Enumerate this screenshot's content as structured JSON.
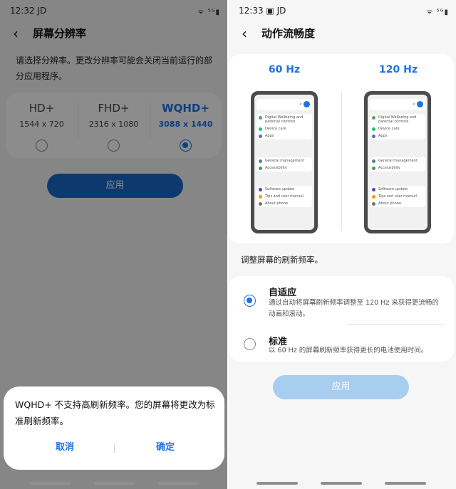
{
  "left": {
    "status_time": "12:32",
    "status_carrier": "JD",
    "status_icons": "ᯤ ⁵ᴳ▮",
    "title": "屏幕分辨率",
    "description": "请选择分辨率。更改分辨率可能会关闭当前运行的部分应用程序。",
    "resolutions": [
      {
        "name": "HD+",
        "dims": "1544 x 720",
        "selected": false
      },
      {
        "name": "FHD+",
        "dims": "2316 x 1080",
        "selected": false
      },
      {
        "name": "WQHD+",
        "dims": "3088 x 1440",
        "selected": true
      }
    ],
    "apply_label": "应用",
    "dialog": {
      "message": "WQHD+ 不支持高刷新频率。您的屏幕将更改为标准刷新频率。",
      "cancel_label": "取消",
      "ok_label": "确定"
    }
  },
  "right": {
    "status_time": "12:33",
    "status_carrier": "JD",
    "status_icons": "ᯤ ⁵ᴳ▮",
    "title": "动作流畅度",
    "hz_labels": [
      "60 Hz",
      "120 Hz"
    ],
    "phone_menu": [
      [
        "Digital Wellbeing and parental controls",
        "Device care",
        "Apps"
      ],
      [
        "General management",
        "Accessibility"
      ],
      [
        "Software update",
        "Tips and user manual",
        "About phone"
      ]
    ],
    "refresh_desc": "调整屏幕的刷新频率。",
    "options": [
      {
        "title": "自适应",
        "subtitle": "通过自动将屏幕刷新频率调整至 120 Hz 来获得更流畅的动画和滚动。",
        "selected": true
      },
      {
        "title": "标准",
        "subtitle": "以 60 Hz 的屏幕刷新频率获得更长的电池使用时间。",
        "selected": false
      }
    ],
    "apply_label": "应用"
  },
  "colors": {
    "accent": "#1a73e8",
    "apply_active": "#1968c9",
    "apply_disabled": "#a7cdef",
    "overlay": "rgba(0,0,0,0.45)"
  }
}
